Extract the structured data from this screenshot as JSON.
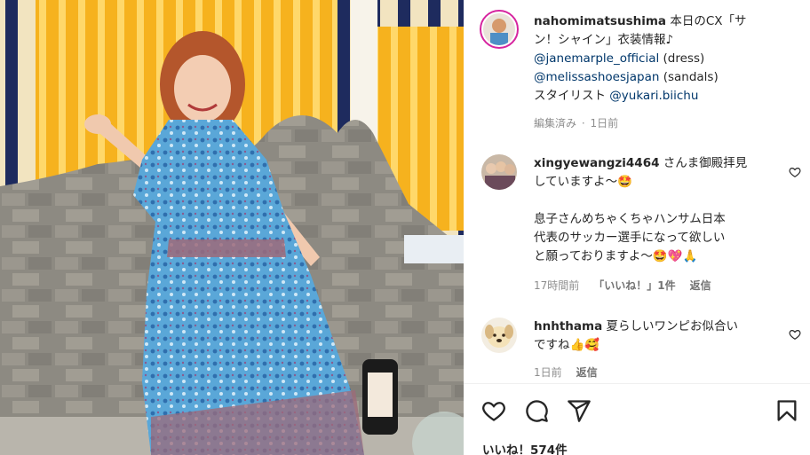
{
  "post": {
    "username": "nahomimatsushima",
    "caption_lines": [
      "本日のCX「サ",
      "ン！シャイン」衣装情報♪"
    ],
    "mentions": [
      {
        "handle": "@janemarple_official",
        "suffix": " (dress)"
      },
      {
        "handle": "@melissashoesjapan",
        "suffix": " (sandals)"
      }
    ],
    "stylist_label": "スタイリスト ",
    "stylist_handle": "@yukari.biichu",
    "edited": "編集済み",
    "time": "1日前"
  },
  "comments": [
    {
      "username": "xingyewangzi4464",
      "text_lines": [
        "さんま御殿拝見",
        "していますよ〜🤩"
      ],
      "text2_lines": [
        "息子さんめちゃくちゃハンサム日本",
        "代表のサッカー選手になって欲しい",
        "と願っておりますよ〜🤩💖🙏"
      ],
      "time": "17時間前",
      "likes": "「いいね！」1件",
      "reply": "返信"
    },
    {
      "username": "hnhthama",
      "text_lines": [
        "夏らしいワンピお似合い",
        "ですね👍🥰"
      ],
      "time": "1日前",
      "reply": "返信"
    }
  ],
  "likes_count": "いいね！574件",
  "icons": {
    "like": "heart-icon",
    "comment": "comment-icon",
    "share": "share-icon",
    "save": "bookmark-icon"
  },
  "colors": {
    "story_ring": "#d6249f",
    "mention": "#00376b",
    "meta": "#8e8e8e"
  }
}
